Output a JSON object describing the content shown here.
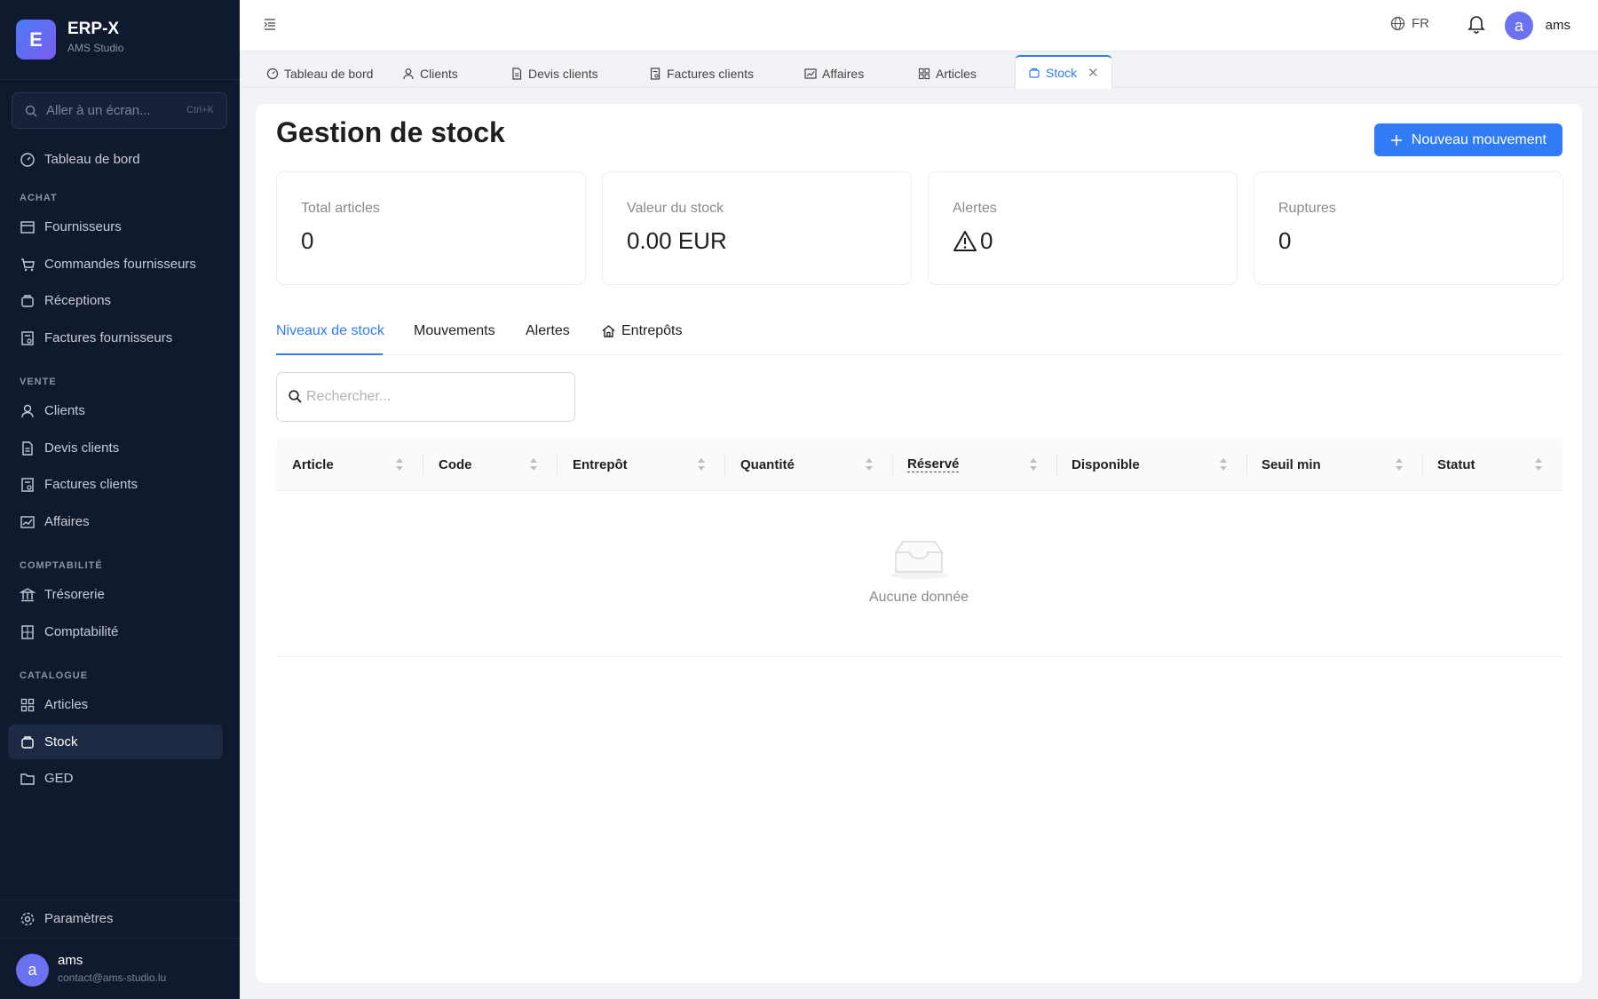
{
  "brand": {
    "logo_letter": "E",
    "name": "ERP-X",
    "subtitle": "AMS Studio"
  },
  "sidebar": {
    "search_placeholder": "Aller à un écran...",
    "search_shortcut": "Ctrl+K",
    "dashboard": "Tableau de bord",
    "sections": {
      "achat": "ACHAT",
      "vente": "VENTE",
      "comptabilite": "COMPTABILITÉ",
      "catalogue": "CATALOGUE"
    },
    "items": {
      "fournisseurs": "Fournisseurs",
      "commandes_fournisseurs": "Commandes fournisseurs",
      "receptions": "Réceptions",
      "factures_fournisseurs": "Factures fournisseurs",
      "clients": "Clients",
      "devis_clients": "Devis clients",
      "factures_clients": "Factures clients",
      "affaires": "Affaires",
      "tresorerie": "Trésorerie",
      "comptabilite": "Comptabilité",
      "articles": "Articles",
      "stock": "Stock",
      "ged": "GED"
    },
    "settings": "Paramètres",
    "user": {
      "avatar": "a",
      "name": "ams",
      "email": "contact@ams-studio.lu"
    }
  },
  "header": {
    "language": "FR",
    "user_avatar": "a",
    "user_name": "ams"
  },
  "tabs": [
    {
      "label": "Tableau de bord",
      "icon": "dashboard-icon"
    },
    {
      "label": "Clients",
      "icon": "user-icon"
    },
    {
      "label": "Devis clients",
      "icon": "document-icon"
    },
    {
      "label": "Factures clients",
      "icon": "invoice-icon"
    },
    {
      "label": "Affaires",
      "icon": "chart-icon"
    },
    {
      "label": "Articles",
      "icon": "grid-icon"
    },
    {
      "label": "Stock",
      "icon": "box-icon",
      "active": true
    }
  ],
  "page": {
    "title": "Gestion de stock",
    "new_button": "Nouveau mouvement",
    "stats": [
      {
        "label": "Total articles",
        "value": "0"
      },
      {
        "label": "Valeur du stock",
        "value": "0.00 EUR"
      },
      {
        "label": "Alertes",
        "value": "0"
      },
      {
        "label": "Ruptures",
        "value": "0"
      }
    ],
    "content_tabs": [
      "Niveaux de stock",
      "Mouvements",
      "Alertes",
      "Entrepôts"
    ],
    "search_placeholder": "Rechercher...",
    "columns": [
      "Article",
      "Code",
      "Entrepôt",
      "Quantité",
      "Réservé",
      "Disponible",
      "Seuil min",
      "Statut"
    ],
    "empty_text": "Aucune donnée"
  },
  "colors": {
    "accent": "#2f7cf6",
    "sidebar_bg": "#101a2e",
    "avatar": "#6a72f0"
  }
}
